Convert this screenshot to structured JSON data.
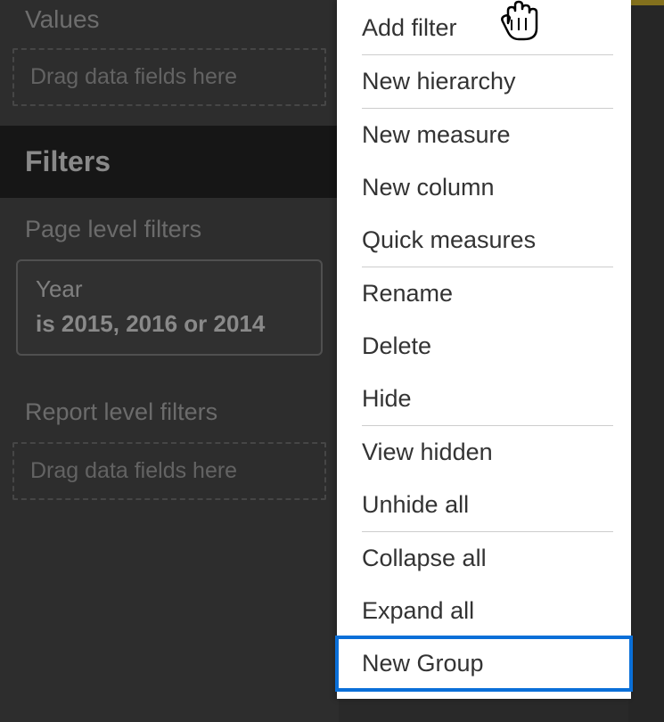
{
  "panel": {
    "values_heading": "Values",
    "drop_hint_values": "Drag data fields here",
    "filters_heading": "Filters",
    "page_level_heading": "Page level filters",
    "report_level_heading": "Report level filters",
    "drop_hint_report": "Drag data fields here",
    "filter_card": {
      "field": "Year",
      "condition": "is 2015, 2016 or 2014"
    }
  },
  "menu": {
    "items": [
      "Add filter",
      "New hierarchy",
      "New measure",
      "New column",
      "Quick measures",
      "Rename",
      "Delete",
      "Hide",
      "View hidden",
      "Unhide all",
      "Collapse all",
      "Expand all",
      "New Group"
    ]
  }
}
